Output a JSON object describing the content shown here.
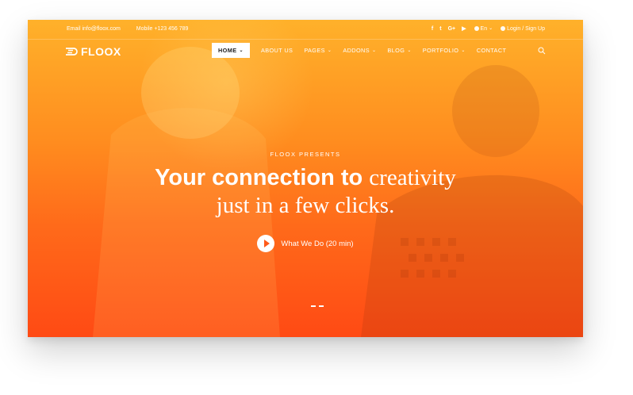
{
  "topbar": {
    "email": "Email info@floox.com",
    "mobile": "Mobile +123 456 789",
    "social": [
      "f",
      "t",
      "G+",
      "▶"
    ],
    "language": "En",
    "login": "Login / Sign Up"
  },
  "navbar": {
    "logo": "FLOOX",
    "items": [
      {
        "label": "HOME",
        "active": true
      },
      {
        "label": "ABOUT US"
      },
      {
        "label": "PAGES"
      },
      {
        "label": "ADDONS"
      },
      {
        "label": "BLOG"
      },
      {
        "label": "PORTFOLIO"
      },
      {
        "label": "CONTACT"
      }
    ]
  },
  "hero": {
    "eyebrow": "FLOOX PRESENTS",
    "headline_strong": "Your connection to",
    "headline_serif": "creativity",
    "headline_line2": "just in a few clicks.",
    "cta_label": "What We Do (20 min)"
  },
  "colors": {
    "gradient_top": "#ffb12a",
    "gradient_bottom": "#ff4a14",
    "accent": "#ff5a1a"
  }
}
